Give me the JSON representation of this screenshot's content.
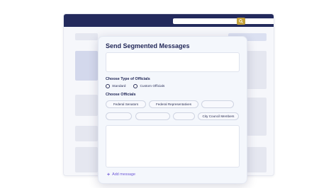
{
  "modal": {
    "title": "Send Segmented Messages",
    "officials_type_label": "Choose Type of Officials",
    "radio_options": [
      "Standard",
      "Custom Officials"
    ],
    "choose_officials_label": "Choose Officials",
    "chips_row1": [
      "Federal Senators",
      "Federal Representatives",
      ""
    ],
    "chips_row2": [
      "",
      "",
      "",
      "City Council Members"
    ],
    "add_message_label": "Add message",
    "add_icon": "+"
  },
  "colors": {
    "header": "#232a5c",
    "search_button": "#c4a23a",
    "accent": "#6f5ad8",
    "title_text": "#1f2556"
  },
  "icons": {
    "search": "search-icon",
    "add": "plus-icon"
  }
}
